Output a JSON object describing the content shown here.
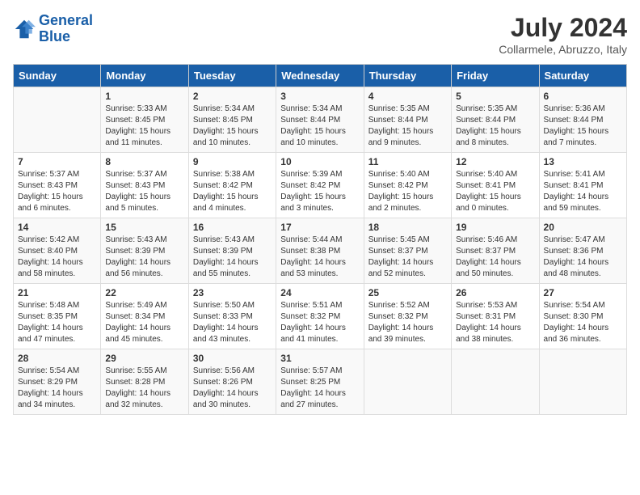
{
  "logo": {
    "text_general": "General",
    "text_blue": "Blue"
  },
  "title": {
    "month_year": "July 2024",
    "location": "Collarmele, Abruzzo, Italy"
  },
  "weekdays": [
    "Sunday",
    "Monday",
    "Tuesday",
    "Wednesday",
    "Thursday",
    "Friday",
    "Saturday"
  ],
  "weeks": [
    [
      {
        "day": "",
        "sunrise": "",
        "sunset": "",
        "daylight": ""
      },
      {
        "day": "1",
        "sunrise": "Sunrise: 5:33 AM",
        "sunset": "Sunset: 8:45 PM",
        "daylight": "Daylight: 15 hours and 11 minutes."
      },
      {
        "day": "2",
        "sunrise": "Sunrise: 5:34 AM",
        "sunset": "Sunset: 8:45 PM",
        "daylight": "Daylight: 15 hours and 10 minutes."
      },
      {
        "day": "3",
        "sunrise": "Sunrise: 5:34 AM",
        "sunset": "Sunset: 8:44 PM",
        "daylight": "Daylight: 15 hours and 10 minutes."
      },
      {
        "day": "4",
        "sunrise": "Sunrise: 5:35 AM",
        "sunset": "Sunset: 8:44 PM",
        "daylight": "Daylight: 15 hours and 9 minutes."
      },
      {
        "day": "5",
        "sunrise": "Sunrise: 5:35 AM",
        "sunset": "Sunset: 8:44 PM",
        "daylight": "Daylight: 15 hours and 8 minutes."
      },
      {
        "day": "6",
        "sunrise": "Sunrise: 5:36 AM",
        "sunset": "Sunset: 8:44 PM",
        "daylight": "Daylight: 15 hours and 7 minutes."
      }
    ],
    [
      {
        "day": "7",
        "sunrise": "Sunrise: 5:37 AM",
        "sunset": "Sunset: 8:43 PM",
        "daylight": "Daylight: 15 hours and 6 minutes."
      },
      {
        "day": "8",
        "sunrise": "Sunrise: 5:37 AM",
        "sunset": "Sunset: 8:43 PM",
        "daylight": "Daylight: 15 hours and 5 minutes."
      },
      {
        "day": "9",
        "sunrise": "Sunrise: 5:38 AM",
        "sunset": "Sunset: 8:42 PM",
        "daylight": "Daylight: 15 hours and 4 minutes."
      },
      {
        "day": "10",
        "sunrise": "Sunrise: 5:39 AM",
        "sunset": "Sunset: 8:42 PM",
        "daylight": "Daylight: 15 hours and 3 minutes."
      },
      {
        "day": "11",
        "sunrise": "Sunrise: 5:40 AM",
        "sunset": "Sunset: 8:42 PM",
        "daylight": "Daylight: 15 hours and 2 minutes."
      },
      {
        "day": "12",
        "sunrise": "Sunrise: 5:40 AM",
        "sunset": "Sunset: 8:41 PM",
        "daylight": "Daylight: 15 hours and 0 minutes."
      },
      {
        "day": "13",
        "sunrise": "Sunrise: 5:41 AM",
        "sunset": "Sunset: 8:41 PM",
        "daylight": "Daylight: 14 hours and 59 minutes."
      }
    ],
    [
      {
        "day": "14",
        "sunrise": "Sunrise: 5:42 AM",
        "sunset": "Sunset: 8:40 PM",
        "daylight": "Daylight: 14 hours and 58 minutes."
      },
      {
        "day": "15",
        "sunrise": "Sunrise: 5:43 AM",
        "sunset": "Sunset: 8:39 PM",
        "daylight": "Daylight: 14 hours and 56 minutes."
      },
      {
        "day": "16",
        "sunrise": "Sunrise: 5:43 AM",
        "sunset": "Sunset: 8:39 PM",
        "daylight": "Daylight: 14 hours and 55 minutes."
      },
      {
        "day": "17",
        "sunrise": "Sunrise: 5:44 AM",
        "sunset": "Sunset: 8:38 PM",
        "daylight": "Daylight: 14 hours and 53 minutes."
      },
      {
        "day": "18",
        "sunrise": "Sunrise: 5:45 AM",
        "sunset": "Sunset: 8:37 PM",
        "daylight": "Daylight: 14 hours and 52 minutes."
      },
      {
        "day": "19",
        "sunrise": "Sunrise: 5:46 AM",
        "sunset": "Sunset: 8:37 PM",
        "daylight": "Daylight: 14 hours and 50 minutes."
      },
      {
        "day": "20",
        "sunrise": "Sunrise: 5:47 AM",
        "sunset": "Sunset: 8:36 PM",
        "daylight": "Daylight: 14 hours and 48 minutes."
      }
    ],
    [
      {
        "day": "21",
        "sunrise": "Sunrise: 5:48 AM",
        "sunset": "Sunset: 8:35 PM",
        "daylight": "Daylight: 14 hours and 47 minutes."
      },
      {
        "day": "22",
        "sunrise": "Sunrise: 5:49 AM",
        "sunset": "Sunset: 8:34 PM",
        "daylight": "Daylight: 14 hours and 45 minutes."
      },
      {
        "day": "23",
        "sunrise": "Sunrise: 5:50 AM",
        "sunset": "Sunset: 8:33 PM",
        "daylight": "Daylight: 14 hours and 43 minutes."
      },
      {
        "day": "24",
        "sunrise": "Sunrise: 5:51 AM",
        "sunset": "Sunset: 8:32 PM",
        "daylight": "Daylight: 14 hours and 41 minutes."
      },
      {
        "day": "25",
        "sunrise": "Sunrise: 5:52 AM",
        "sunset": "Sunset: 8:32 PM",
        "daylight": "Daylight: 14 hours and 39 minutes."
      },
      {
        "day": "26",
        "sunrise": "Sunrise: 5:53 AM",
        "sunset": "Sunset: 8:31 PM",
        "daylight": "Daylight: 14 hours and 38 minutes."
      },
      {
        "day": "27",
        "sunrise": "Sunrise: 5:54 AM",
        "sunset": "Sunset: 8:30 PM",
        "daylight": "Daylight: 14 hours and 36 minutes."
      }
    ],
    [
      {
        "day": "28",
        "sunrise": "Sunrise: 5:54 AM",
        "sunset": "Sunset: 8:29 PM",
        "daylight": "Daylight: 14 hours and 34 minutes."
      },
      {
        "day": "29",
        "sunrise": "Sunrise: 5:55 AM",
        "sunset": "Sunset: 8:28 PM",
        "daylight": "Daylight: 14 hours and 32 minutes."
      },
      {
        "day": "30",
        "sunrise": "Sunrise: 5:56 AM",
        "sunset": "Sunset: 8:26 PM",
        "daylight": "Daylight: 14 hours and 30 minutes."
      },
      {
        "day": "31",
        "sunrise": "Sunrise: 5:57 AM",
        "sunset": "Sunset: 8:25 PM",
        "daylight": "Daylight: 14 hours and 27 minutes."
      },
      {
        "day": "",
        "sunrise": "",
        "sunset": "",
        "daylight": ""
      },
      {
        "day": "",
        "sunrise": "",
        "sunset": "",
        "daylight": ""
      },
      {
        "day": "",
        "sunrise": "",
        "sunset": "",
        "daylight": ""
      }
    ]
  ]
}
